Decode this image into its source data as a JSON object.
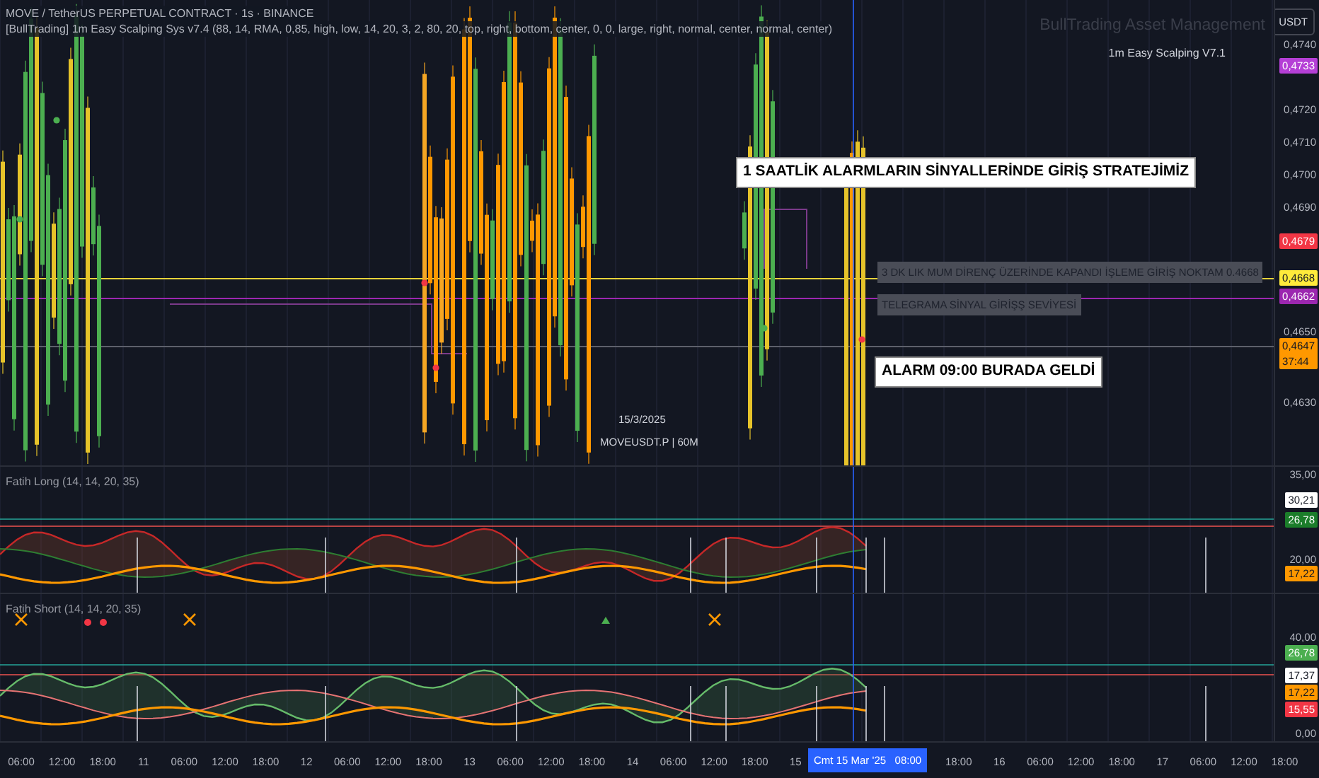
{
  "header": {
    "symbol_line": "MOVE / TetherUS PERPETUAL CONTRACT · 1s · BINANCE",
    "indicator_line": "[BullTrading] 1m Easy Scalping Sys v7.4 (88, 14, RMA, 0,85, high, low, 14, 20, 3, 2, 80, 20, top, right, bottom, center, 0, 0, large, right, normal, center, normal, center)"
  },
  "currency_button": "USDT",
  "overlay_texts": {
    "brand": "BullTrading Asset Management",
    "version": "1m Easy Scalping V7.1"
  },
  "annotations": [
    {
      "kind": "callout",
      "text": "1 SAATLİK ALARMLARIN SİNYALLERİNDE GİRİŞ STRATEJİMİZ"
    },
    {
      "kind": "note",
      "text": "3 DK LIK MUM  DİRENÇ ÜZERİNDE KAPANDI İŞLEME GİRİŞ NOKTAM 0.4668"
    },
    {
      "kind": "note",
      "text": "TELEGRAMA  SİNYAL GİRİŞŞ SEVİYESİ"
    },
    {
      "kind": "callout",
      "text": "ALARM 09:00 BURADA GELDİ"
    }
  ],
  "chart_stamp": {
    "date": "15/3/2025",
    "symbol": "MOVEUSDT.P | 60M"
  },
  "price_axis": {
    "ticks": [
      "0,4740",
      "0,4720",
      "0,4710",
      "0,4700",
      "0,4690",
      "0,4650",
      "0,4630"
    ],
    "markers": [
      {
        "value": "0,4733",
        "color": "#b53fd6"
      },
      {
        "value": "0,4679",
        "color": "#f23645"
      },
      {
        "value": "0,4668",
        "color": "#ffeb3b"
      },
      {
        "value": "0,4662",
        "color": "#9c27b0"
      },
      {
        "value": "0,4647",
        "color": "#ff9800",
        "countdown": "37:44"
      }
    ]
  },
  "panels": [
    {
      "title": "Fatih Long (14, 14, 20, 35)",
      "ticks": [
        "35,00",
        "20,00"
      ],
      "markers": [
        {
          "value": "30,21",
          "color": "#ffffff"
        },
        {
          "value": "26,78",
          "color": "#1b7d2a"
        },
        {
          "value": "17,22",
          "color": "#ff9800"
        }
      ]
    },
    {
      "title": "Fatih Short (14, 14, 20, 35)",
      "ticks": [
        "40,00",
        "0,00"
      ],
      "markers": [
        {
          "value": "26,78",
          "color": "#4caf50"
        },
        {
          "value": "17,37",
          "color": "#ffffff"
        },
        {
          "value": "17,22",
          "color": "#ff9800"
        },
        {
          "value": "15,55",
          "color": "#f23645"
        }
      ]
    }
  ],
  "time_axis": {
    "labels": [
      "06:00",
      "12:00",
      "18:00",
      "11",
      "06:00",
      "12:00",
      "18:00",
      "12",
      "06:00",
      "12:00",
      "18:00",
      "13",
      "06:00",
      "12:00",
      "18:00",
      "14",
      "06:00",
      "12:00",
      "18:00",
      "15",
      "18:00",
      "16",
      "06:00",
      "12:00",
      "18:00",
      "17",
      "06:00",
      "12:00",
      "18:00"
    ],
    "cursor": "Cmt 15 Mar '25   08:00"
  }
}
